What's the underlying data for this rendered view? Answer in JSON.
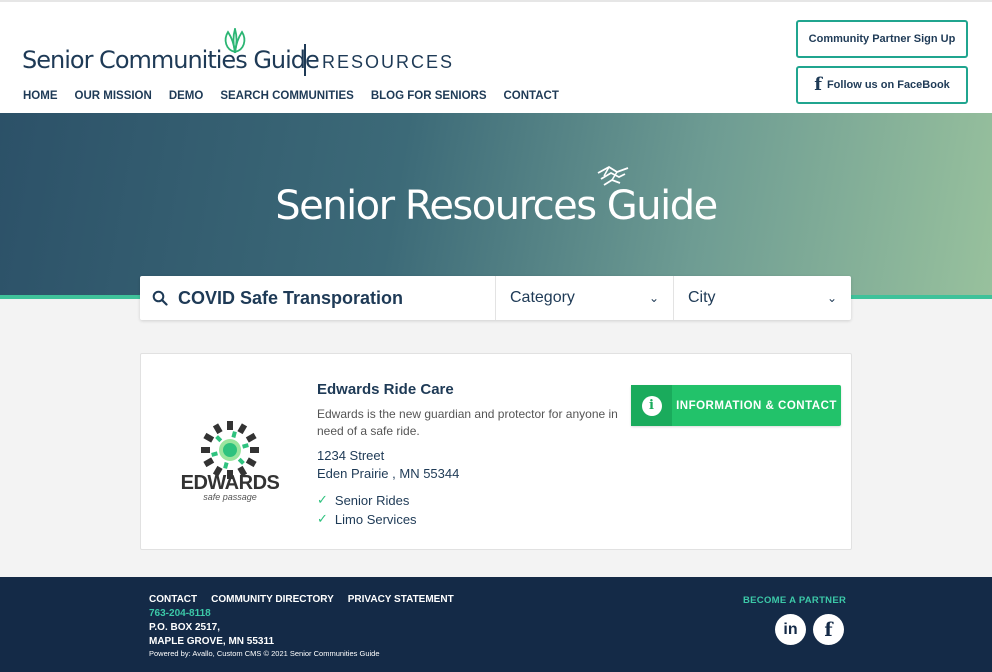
{
  "header": {
    "logo_text": "Senior Communities Guide",
    "logo_section": "RESOURCES",
    "nav": [
      "HOME",
      "OUR MISSION",
      "DEMO",
      "SEARCH COMMUNITIES",
      "BLOG FOR SENIORS",
      "CONTACT"
    ],
    "partner_signup_label": "Community Partner Sign Up",
    "facebook_label": "Follow us on FaceBook"
  },
  "hero": {
    "title": "Senior Resources Guide"
  },
  "search": {
    "query": "COVID Safe Transporation",
    "category_label": "Category",
    "city_label": "City"
  },
  "result": {
    "brand_name": "EDWARDS",
    "brand_tagline": "safe passage",
    "title": "Edwards Ride Care",
    "description": "Edwards is the new guardian and protector for anyone in need of a safe ride.",
    "address_line1": "1234 Street",
    "address_line2": "Eden Prairie , MN 55344",
    "services": [
      "Senior Rides",
      "Limo Services"
    ],
    "info_button_label": "INFORMATION & CONTACT"
  },
  "footer": {
    "links": [
      "CONTACT",
      "COMMUNITY DIRECTORY",
      "PRIVACY STATEMENT"
    ],
    "phone": "763-204-8118",
    "po_box": "P.O. BOX 2517,",
    "city": "MAPLE GROVE, MN 55311",
    "powered": "Powered by: Avallo, Custom CMS © 2021 Senior Communities Guide",
    "partner_link": "BECOME A PARTNER"
  },
  "colors": {
    "navy": "#1e3a56",
    "teal": "#20a58f",
    "green_button": "#22c26a",
    "footer_bg": "#142a47"
  }
}
